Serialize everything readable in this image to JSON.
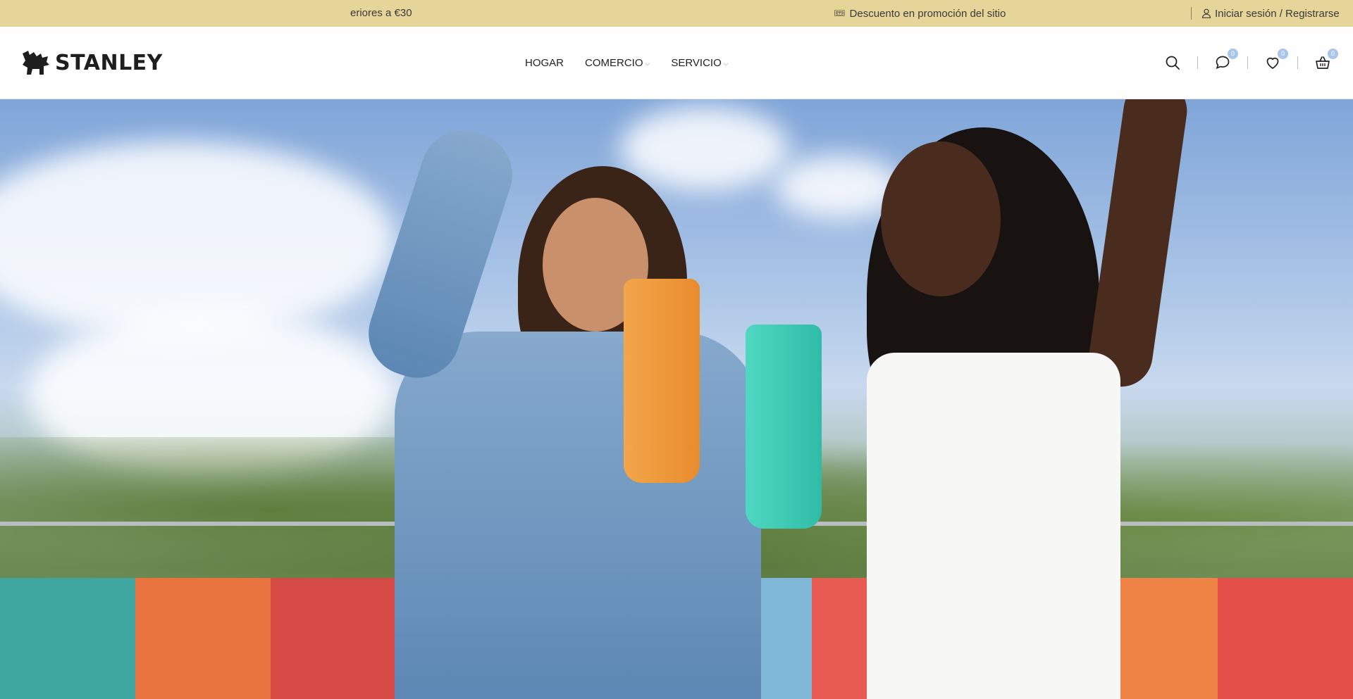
{
  "topbar": {
    "ticker_left": "eriores a €30",
    "ticker_right": "Descuento en promoción del sitio",
    "ticket_icon": "ticket-icon",
    "login_label": "Iniciar sesión / Registrarse",
    "background": "#e6d598"
  },
  "header": {
    "logo_text": "STANLEY",
    "nav": [
      {
        "label": "HOGAR",
        "has_dropdown": false
      },
      {
        "label": "COMERCIO",
        "has_dropdown": true
      },
      {
        "label": "SERVICIO",
        "has_dropdown": true
      }
    ],
    "icons": {
      "search": "search-icon",
      "chat": "chat-icon",
      "wishlist": "heart-icon",
      "cart": "basket-icon"
    },
    "badges": {
      "chat": "0",
      "wishlist": "0",
      "cart": "0"
    },
    "badge_color": "#a9c6e8"
  },
  "hero": {
    "image": "hero-photo"
  }
}
